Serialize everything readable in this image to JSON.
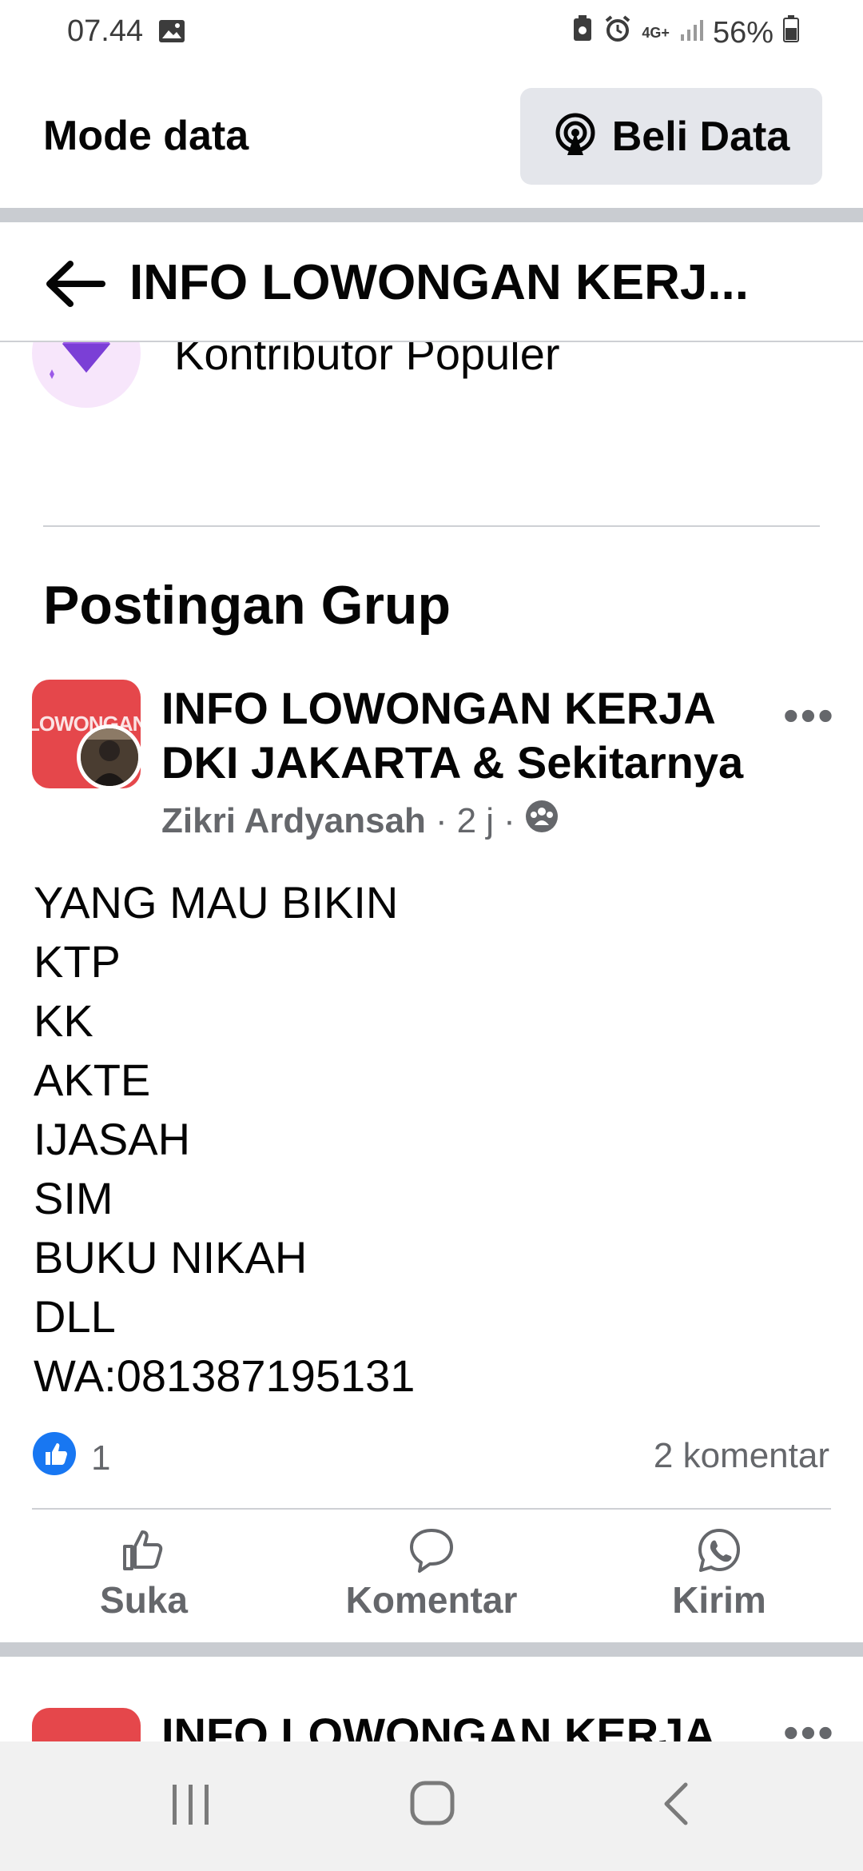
{
  "status_bar": {
    "time": "07.44",
    "network": "4G+",
    "battery": "56%"
  },
  "mode_bar": {
    "title": "Mode data",
    "buy_label": "Beli Data"
  },
  "header": {
    "title": "INFO LOWONGAN KERJ..."
  },
  "contributor": {
    "label": "Kontributor Populer"
  },
  "section_title": "Postingan Grup",
  "post": {
    "avatar_text": "LOWONGAN KERJA",
    "group_name": "INFO LOWONGAN KERJA DKI JAKARTA & Sekitarnya",
    "author": "Zikri Ardyansah",
    "time": "2 j",
    "dot": "·",
    "body_lines": [
      "YANG MAU BIKIN",
      "KTP",
      "KK",
      "AKTE",
      "IJASAH",
      "SIM",
      "BUKU NIKAH",
      "DLL",
      "WA:081387195131"
    ],
    "likes": "1",
    "comments": "2 komentar",
    "actions": {
      "like": "Suka",
      "comment": "Komentar",
      "send": "Kirim"
    },
    "more": "•••"
  },
  "next_post": {
    "group_name": "INFO LOWONGAN KERJA",
    "more": "•••"
  },
  "colors": {
    "like_blue": "#1877f2",
    "avatar_red": "#e5474b",
    "secondary_text": "#65676b"
  }
}
